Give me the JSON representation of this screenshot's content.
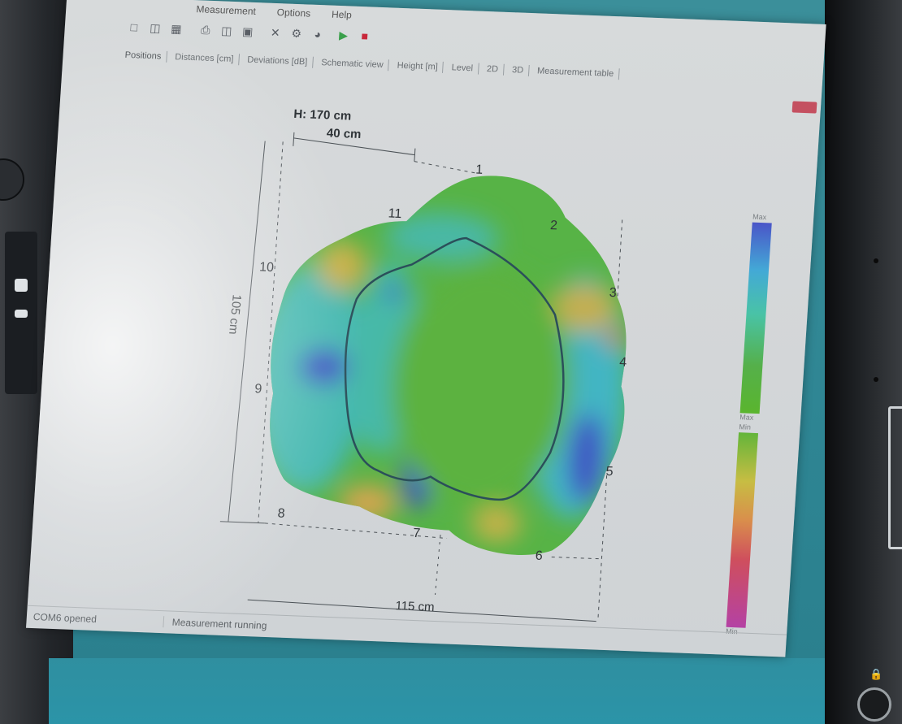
{
  "window": {
    "menu": [
      "Measurement",
      "Options",
      "Help"
    ],
    "toolbar_icons": [
      "new-file-icon",
      "open-icon",
      "save-icon",
      "print-icon",
      "export-icon",
      "delete-icon",
      "settings-icon",
      "play-icon",
      "stop-icon"
    ],
    "tabs": [
      "Positions",
      "Distances [cm]",
      "Deviations [dB]",
      "Schematic view",
      "Height [m]",
      "Level",
      "2D",
      "3D",
      "Measurement table"
    ]
  },
  "plot": {
    "height_label": "H: 170 cm",
    "top_dimension": "40 cm",
    "left_dimension": "105 cm",
    "bottom_dimension": "115 cm",
    "points": [
      "1",
      "2",
      "3",
      "4",
      "5",
      "6",
      "7",
      "8",
      "9",
      "10",
      "11"
    ],
    "colors": {
      "green": "#59b341",
      "teal": "#46b7a7",
      "cyan": "#3fb5cf",
      "blue": "#3f52c2",
      "orange": "#d9b04d",
      "outline": "#2b4f5a"
    }
  },
  "legend": {
    "top_label": "Max",
    "mid_label": "Max",
    "mid_label2": "Min",
    "bottom_label": "Min"
  },
  "status": {
    "port": "COM6 opened",
    "state": "Measurement running"
  },
  "taskbar": {
    "item1": "",
    "item2": ""
  }
}
